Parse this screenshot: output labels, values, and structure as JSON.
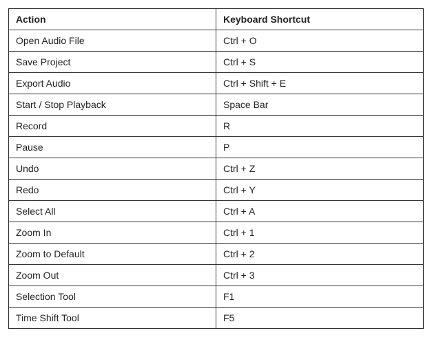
{
  "table": {
    "headers": {
      "action": "Action",
      "shortcut": "Keyboard Shortcut"
    },
    "rows": [
      {
        "action": "Open Audio File",
        "shortcut": "Ctrl + O"
      },
      {
        "action": "Save Project",
        "shortcut": "Ctrl + S"
      },
      {
        "action": "Export Audio",
        "shortcut": "Ctrl + Shift + E"
      },
      {
        "action": "Start / Stop Playback",
        "shortcut": "Space Bar"
      },
      {
        "action": "Record",
        "shortcut": "R"
      },
      {
        "action": "Pause",
        "shortcut": "P"
      },
      {
        "action": "Undo",
        "shortcut": "Ctrl + Z"
      },
      {
        "action": "Redo",
        "shortcut": "Ctrl + Y"
      },
      {
        "action": "Select All",
        "shortcut": "Ctrl + A"
      },
      {
        "action": "Zoom In",
        "shortcut": "Ctrl + 1"
      },
      {
        "action": "Zoom to Default",
        "shortcut": "Ctrl + 2"
      },
      {
        "action": "Zoom Out",
        "shortcut": "Ctrl + 3"
      },
      {
        "action": "Selection Tool",
        "shortcut": "F1"
      },
      {
        "action": "Time Shift Tool",
        "shortcut": "F5"
      }
    ]
  }
}
